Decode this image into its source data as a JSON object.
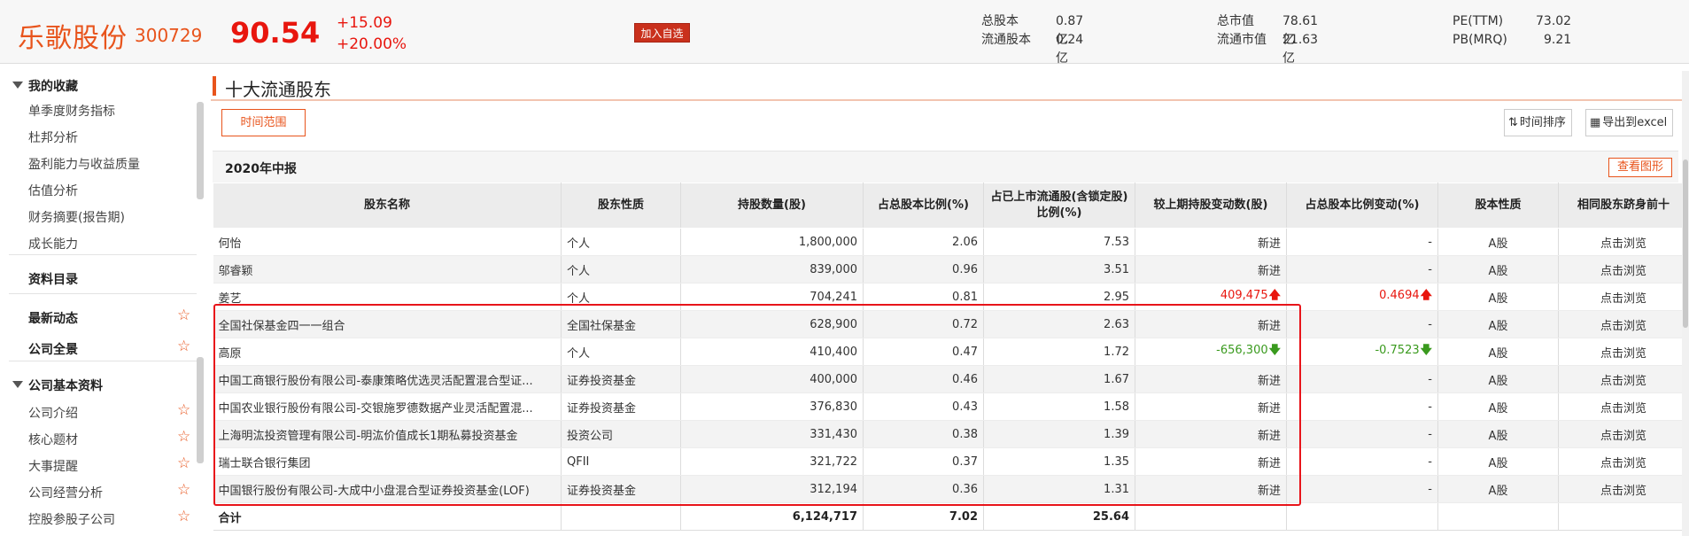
{
  "header": {
    "stock_name": "乐歌股份",
    "stock_code": "300729",
    "price": "90.54",
    "change": "+15.09",
    "change_pct": "+20.00%",
    "add_fav_label": "加入自选",
    "stats": [
      {
        "label": "总股本",
        "value": "0.87 亿"
      },
      {
        "label": "流通股本",
        "value": "0.24 亿"
      },
      {
        "label": "总市值",
        "value": "78.61 亿"
      },
      {
        "label": "流通市值",
        "value": "21.63 亿"
      },
      {
        "label": "PE(TTM)",
        "value": "73.02"
      },
      {
        "label": "PB(MRQ)",
        "value": "9.21"
      }
    ]
  },
  "sidebar": {
    "favorites_title": "我的收藏",
    "favorites": [
      "单季度财务指标",
      "杜邦分析",
      "盈利能力与收益质量",
      "估值分析",
      "财务摘要(报告期)",
      "成长能力"
    ],
    "catalog": "资料目录",
    "latest": "最新动态",
    "overview": "公司全景",
    "basic_title": "公司基本资料",
    "basic_items": [
      "公司介绍",
      "核心题材",
      "大事提醒",
      "公司经营分析",
      "控股参股子公司"
    ]
  },
  "main": {
    "title": "十大流通股东",
    "time_range_label": "时间范围",
    "sort_time_label": "时间排序",
    "export_label": "导出到excel",
    "report_period": "2020年中报",
    "view_chart_label": "查看图形"
  },
  "table": {
    "headers": [
      "股东名称",
      "股东性质",
      "持股数量(股)",
      "占总股本比例(%)",
      "占已上市流通股(含锁定股)比例(%)",
      "较上期持股变动数(股)",
      "占总股本比例变动(%)",
      "股本性质",
      "相同股东跻身前十"
    ],
    "rows": [
      {
        "name": "何怡",
        "type": "个人",
        "shares": "1,800,000",
        "pct_total": "2.06",
        "pct_float": "7.53",
        "change": "新进",
        "change_dir": "",
        "pct_change": "-",
        "pct_dir": "",
        "nature": "A股",
        "link": "点击浏览"
      },
      {
        "name": "邬睿颖",
        "type": "个人",
        "shares": "839,000",
        "pct_total": "0.96",
        "pct_float": "3.51",
        "change": "新进",
        "change_dir": "",
        "pct_change": "-",
        "pct_dir": "",
        "nature": "A股",
        "link": "点击浏览"
      },
      {
        "name": "姜艺",
        "type": "个人",
        "shares": "704,241",
        "pct_total": "0.81",
        "pct_float": "2.95",
        "change": "409,475",
        "change_dir": "up",
        "pct_change": "0.4694",
        "pct_dir": "up",
        "nature": "A股",
        "link": "点击浏览"
      },
      {
        "name": "全国社保基金四一一组合",
        "type": "全国社保基金",
        "shares": "628,900",
        "pct_total": "0.72",
        "pct_float": "2.63",
        "change": "新进",
        "change_dir": "",
        "pct_change": "-",
        "pct_dir": "",
        "nature": "A股",
        "link": "点击浏览"
      },
      {
        "name": "高原",
        "type": "个人",
        "shares": "410,400",
        "pct_total": "0.47",
        "pct_float": "1.72",
        "change": "-656,300",
        "change_dir": "down",
        "pct_change": "-0.7523",
        "pct_dir": "down",
        "nature": "A股",
        "link": "点击浏览"
      },
      {
        "name": "中国工商银行股份有限公司-泰康策略优选灵活配置混合型证...",
        "type": "证券投资基金",
        "shares": "400,000",
        "pct_total": "0.46",
        "pct_float": "1.67",
        "change": "新进",
        "change_dir": "",
        "pct_change": "-",
        "pct_dir": "",
        "nature": "A股",
        "link": "点击浏览"
      },
      {
        "name": "中国农业银行股份有限公司-交银施罗德数据产业灵活配置混...",
        "type": "证券投资基金",
        "shares": "376,830",
        "pct_total": "0.43",
        "pct_float": "1.58",
        "change": "新进",
        "change_dir": "",
        "pct_change": "-",
        "pct_dir": "",
        "nature": "A股",
        "link": "点击浏览"
      },
      {
        "name": "上海明汯投资管理有限公司-明汯价值成长1期私募投资基金",
        "type": "投资公司",
        "shares": "331,430",
        "pct_total": "0.38",
        "pct_float": "1.39",
        "change": "新进",
        "change_dir": "",
        "pct_change": "-",
        "pct_dir": "",
        "nature": "A股",
        "link": "点击浏览"
      },
      {
        "name": "瑞士联合银行集团",
        "type": "QFII",
        "shares": "321,722",
        "pct_total": "0.37",
        "pct_float": "1.35",
        "change": "新进",
        "change_dir": "",
        "pct_change": "-",
        "pct_dir": "",
        "nature": "A股",
        "link": "点击浏览"
      },
      {
        "name": "中国银行股份有限公司-大成中小盘混合型证券投资基金(LOF)",
        "type": "证券投资基金",
        "shares": "312,194",
        "pct_total": "0.36",
        "pct_float": "1.31",
        "change": "新进",
        "change_dir": "",
        "pct_change": "-",
        "pct_dir": "",
        "nature": "A股",
        "link": "点击浏览"
      }
    ],
    "total": {
      "label": "合计",
      "shares": "6,124,717",
      "pct_total": "7.02",
      "pct_float": "25.64"
    }
  },
  "colors": {
    "accent": "#e8541c",
    "up": "#e8160e",
    "down": "#3a9a1e",
    "link": "#1a4fbb",
    "highlight": "#e8141a"
  }
}
